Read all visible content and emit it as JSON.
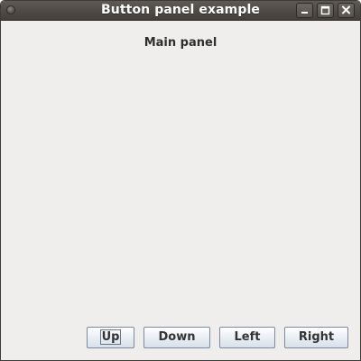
{
  "window": {
    "title": "Button panel example",
    "controls": {
      "minimize_icon": "minimize-icon",
      "maximize_icon": "maximize-icon",
      "close_icon": "close-icon"
    }
  },
  "main_panel": {
    "label": "Main panel"
  },
  "buttons": {
    "up": "Up",
    "down": "Down",
    "left": "Left",
    "right": "Right",
    "focused": "up"
  },
  "colors": {
    "titlebar": "#4e4a46",
    "background": "#efeeed",
    "button_border": "#7a8aa0"
  }
}
